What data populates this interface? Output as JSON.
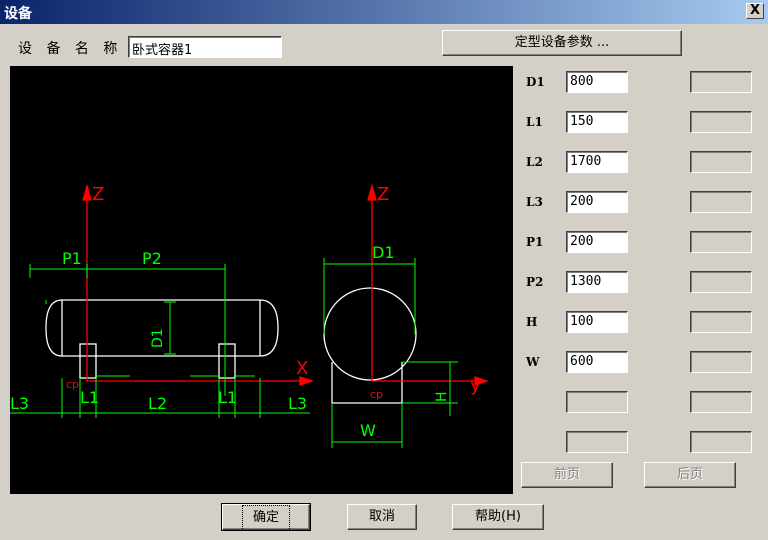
{
  "window": {
    "title": "设备",
    "close_symbol": "X"
  },
  "name_label": "设 备 名 称 :",
  "name_value": "卧式容器1",
  "preset_button": "定型设备参数 ...",
  "params": [
    {
      "label": "D1",
      "value": "800"
    },
    {
      "label": "L1",
      "value": "150"
    },
    {
      "label": "L2",
      "value": "1700"
    },
    {
      "label": "L3",
      "value": "200"
    },
    {
      "label": "P1",
      "value": "200"
    },
    {
      "label": "P2",
      "value": "1300"
    },
    {
      "label": "H",
      "value": "100"
    },
    {
      "label": "W",
      "value": "600"
    }
  ],
  "buttons": {
    "prev_page": "前页",
    "next_page": "后页",
    "ok": "确定",
    "cancel": "取消",
    "help": "帮助(H)"
  },
  "drawing": {
    "side_view": {
      "axis_z": "Z",
      "axis_x": "X",
      "cp": "cp",
      "dims": {
        "P1": "P1",
        "P2": "P2",
        "D1": "D1",
        "L1_left": "L1",
        "L2": "L2",
        "L1_right": "L1",
        "L3_left": "L3",
        "L3_right": "L3"
      }
    },
    "end_view": {
      "axis_z": "Z",
      "axis_y": "y",
      "cp": "cp",
      "dims": {
        "D1": "D1",
        "H": "H",
        "W": "W"
      }
    },
    "colors": {
      "background": "#000000",
      "outline": "#ffffff",
      "dimension": "#00ff00",
      "axis": "#ff0000"
    }
  }
}
